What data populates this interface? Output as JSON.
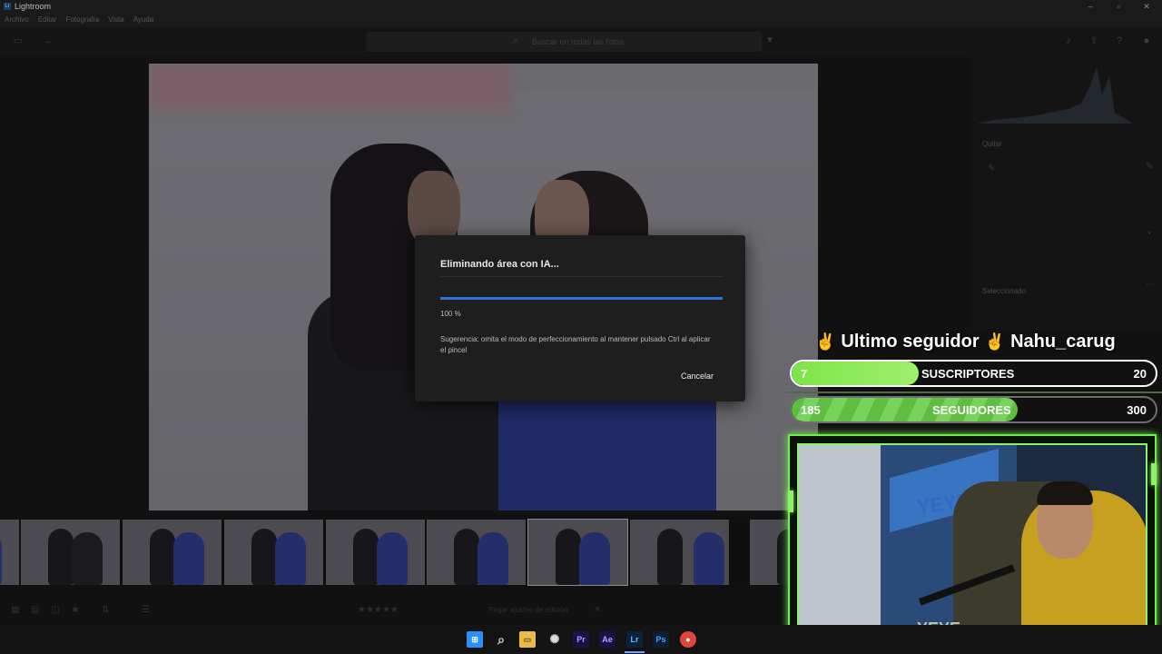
{
  "app": {
    "title": "Lightroom",
    "badge": "Lr"
  },
  "menu": [
    "Archivo",
    "Editar",
    "Fotografía",
    "Vista",
    "Ayuda"
  ],
  "search": {
    "placeholder": "Buscar en todas las fotos"
  },
  "panel": {
    "section_remove": "Quitar",
    "section_selected": "Seleccionado"
  },
  "dialog": {
    "title": "Eliminando área con IA...",
    "progress": 1.0,
    "progress_label": "100 %",
    "hint": "Sugerencia: omita el modo de perfeccionamiento al mantener pulsado Ctrl al aplicar el pincel",
    "cancel_label": "Cancelar",
    "accent": "#2a73d9"
  },
  "filmstrip": {
    "thumb_count": 8,
    "selected_index": 5
  },
  "bottombar": {
    "status": "Pegar ajustes de edición"
  },
  "overlay": {
    "follower_banner": "Ultimo seguidor",
    "follower_name": "Nahu_carug",
    "subs": {
      "current": "7",
      "label": "SUSCRIPTORES",
      "goal": "20",
      "fraction": 0.35
    },
    "follows": {
      "current": "185",
      "label": "SEGUIDORES",
      "goal": "300",
      "fraction": 0.62
    },
    "cam_brand": "YEYE",
    "accent": "#6cf04a"
  },
  "taskbar": {
    "icons": [
      "windows-start",
      "search",
      "file-explorer",
      "davinci",
      "premiere",
      "after-effects",
      "lightroom",
      "photoshop",
      "chrome"
    ],
    "labels": {
      "premiere": "Pr",
      "after_effects": "Ae",
      "lightroom": "Lr",
      "photoshop": "Ps"
    }
  }
}
